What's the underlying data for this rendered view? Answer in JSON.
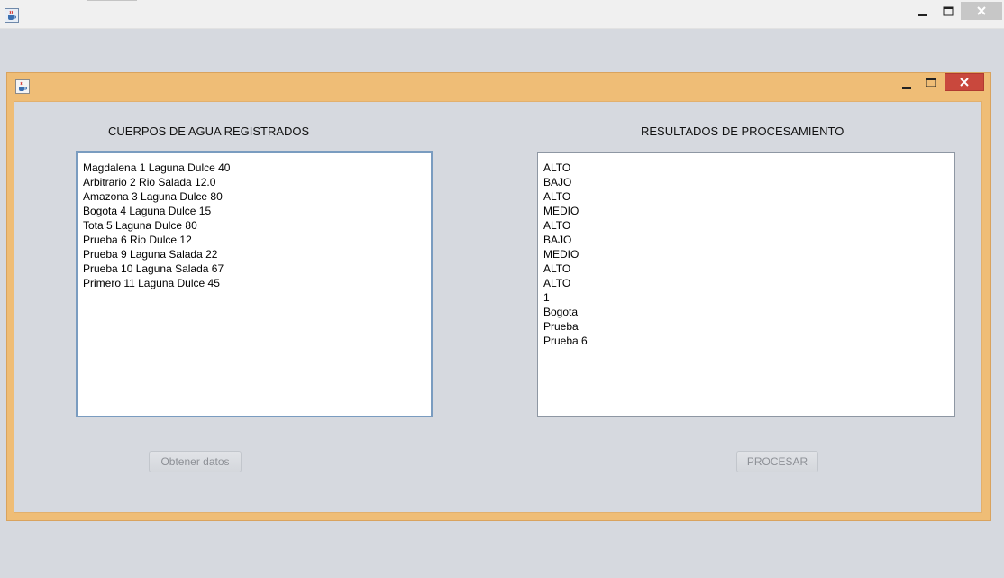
{
  "window": {
    "icon": "java-coffee-icon",
    "controls": [
      "minimize-icon",
      "maximize-icon",
      "close-icon"
    ]
  },
  "internal_frame": {
    "icon": "java-coffee-icon",
    "left_panel": {
      "title": "CUERPOS DE AGUA REGISTRADOS",
      "items": [
        "Magdalena 1 Laguna Dulce 40",
        "Arbitrario 2 Rio Salada 12.0",
        "Amazona 3 Laguna Dulce 80",
        "Bogota 4 Laguna Dulce 15",
        "Tota 5 Laguna Dulce 80",
        "Prueba 6 Rio Dulce 12",
        "Prueba 9 Laguna Salada 22",
        "Prueba 10 Laguna Salada 67",
        "Primero 11 Laguna Dulce 45"
      ],
      "button_label": "Obtener datos"
    },
    "right_panel": {
      "title": "RESULTADOS DE PROCESAMIENTO",
      "items": [
        "ALTO",
        "BAJO",
        "ALTO",
        "MEDIO",
        "ALTO",
        "BAJO",
        "MEDIO",
        "ALTO",
        "ALTO",
        "1",
        "Bogota",
        "Prueba",
        "Prueba 6"
      ],
      "button_label": "PROCESAR"
    }
  },
  "colors": {
    "frame_border": "#efbd76",
    "close_active": "#c9483d",
    "background": "#d6d9df"
  }
}
